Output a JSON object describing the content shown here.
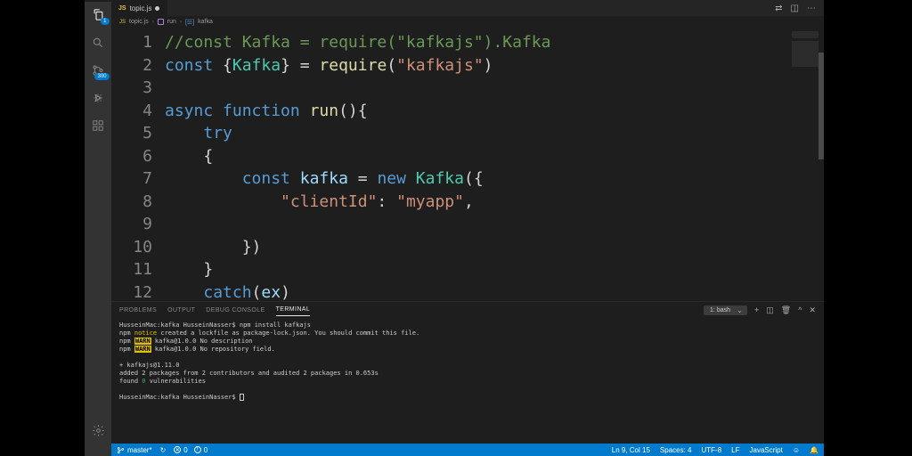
{
  "tab": {
    "filename": "topic.js",
    "modified": true
  },
  "breadcrumb": {
    "file": "topic.js",
    "fn1": "run",
    "fn2": "kafka"
  },
  "code": {
    "lines": [
      1,
      2,
      3,
      4,
      5,
      6,
      7,
      8,
      9,
      10,
      11,
      12
    ],
    "l1_comment": "//const Kafka = require(\"kafkajs\").Kafka",
    "l2_const": "const ",
    "l2_brace_open": "{",
    "l2_kafka": "Kafka",
    "l2_brace_close": "}",
    "l2_eq": " = ",
    "l2_require": "require",
    "l2_paren1": "(",
    "l2_str": "\"kafkajs\"",
    "l2_paren2": ")",
    "l4_async": "async ",
    "l4_function": "function ",
    "l4_run": "run",
    "l4_paren": "(){",
    "l5_try": "try",
    "l6_brace": "{",
    "l7_const": "const ",
    "l7_kafka": "kafka",
    "l7_eq": " = ",
    "l7_new": "new ",
    "l7_Kafka": "Kafka",
    "l7_paren": "({",
    "l8_prop": "\"clientId\"",
    "l8_colon": ": ",
    "l8_val": "\"myapp\"",
    "l8_comma": ",",
    "l10_close": "})",
    "l11_brace": "}",
    "l12_catch": "catch",
    "l12_paren1": "(",
    "l12_ex": "ex",
    "l12_paren2": ")"
  },
  "panel": {
    "tabs": {
      "problems": "PROBLEMS",
      "output": "OUTPUT",
      "debug": "DEBUG CONSOLE",
      "terminal": "TERMINAL"
    },
    "term_shell": "1: bash"
  },
  "terminal_lines": {
    "l1_prompt": "HusseinMac:kafka HusseinNasser$ ",
    "l1_cmd": "npm install kafkajs",
    "l2a": "npm ",
    "l2_notice": "notice",
    "l2b": " created a lockfile as package-lock.json. You should commit this file.",
    "l3a": "npm ",
    "l3_warn": "WARN",
    "l3b": " kafka@1.0.0 No description",
    "l4a": "npm ",
    "l4_warn": "WARN",
    "l4b": " kafka@1.0.0 No repository field.",
    "l6": "+ kafkajs@1.11.0",
    "l7a": "added 2 packages from 2 contributors and audited 2 packages in 0.653s",
    "l8a": "found ",
    "l8_zero": "0",
    "l8b": " vulnerabilities",
    "l10_prompt": "HusseinMac:kafka HusseinNasser$ "
  },
  "statusbar": {
    "branch": "master*",
    "sync": "↻",
    "errors": "0",
    "warnings": "0",
    "ln_col": "Ln 9, Col 15",
    "spaces": "Spaces: 4",
    "encoding": "UTF-8",
    "eol": "LF",
    "lang": "JavaScript",
    "feedback": "☺"
  },
  "scm_badge": "300"
}
